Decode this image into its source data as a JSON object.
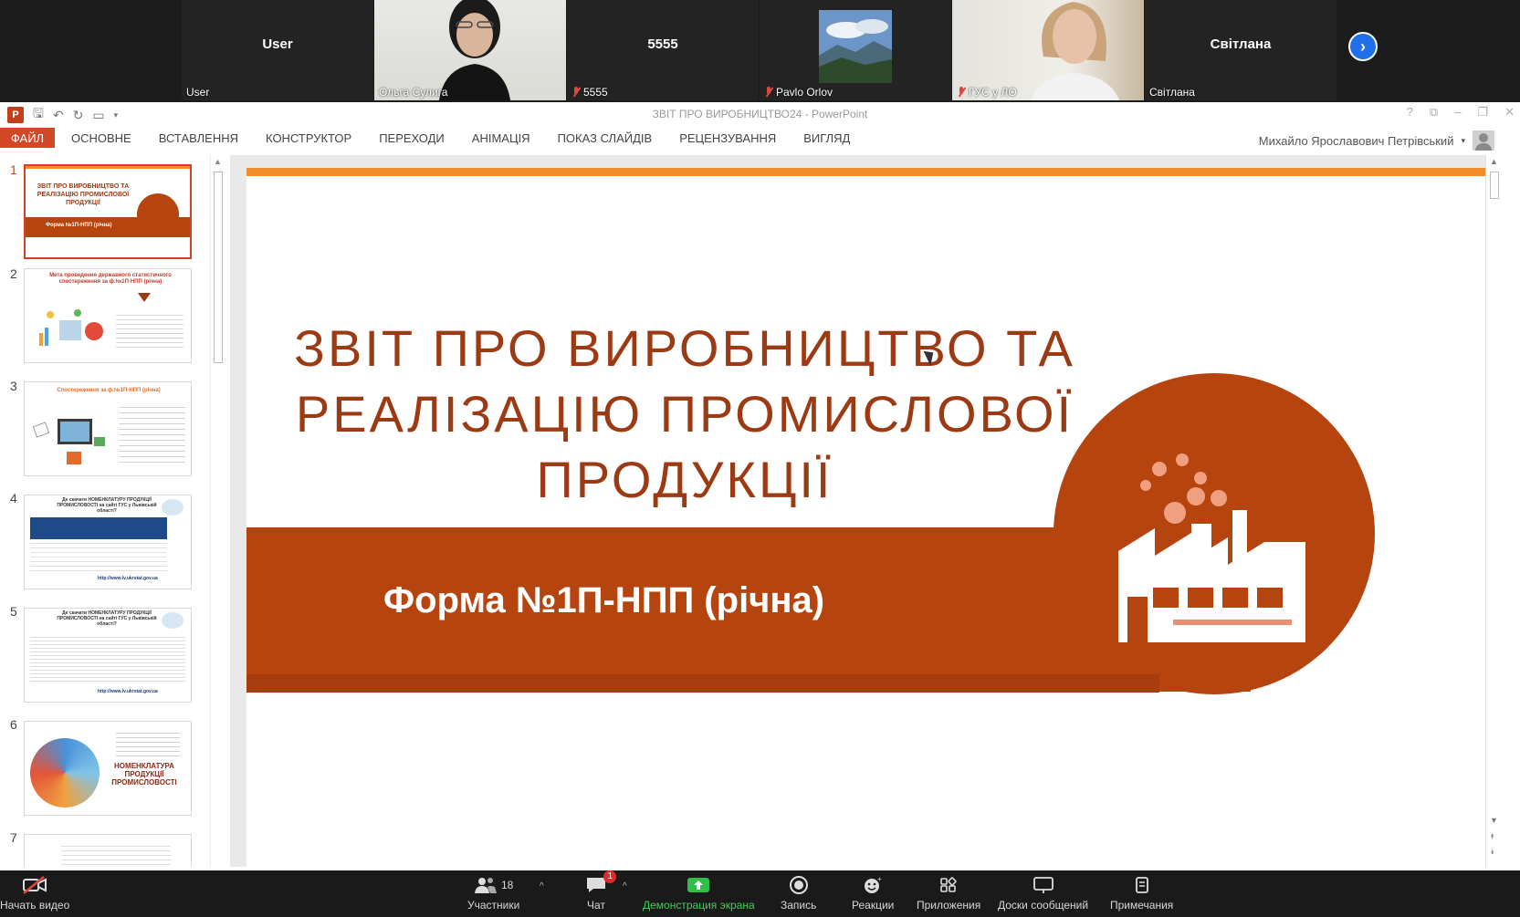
{
  "participants": {
    "tiles": [
      {
        "center_name": "User",
        "label": "User",
        "muted": false
      },
      {
        "center_name": "",
        "label": "Ольга Сулига",
        "muted": false,
        "video": true,
        "active": true
      },
      {
        "center_name": "5555",
        "label": "5555",
        "muted": true
      },
      {
        "center_name": "",
        "label": "Pavlo Orlov",
        "muted": true,
        "avatar_image": true
      },
      {
        "center_name": "",
        "label": "ГУС у ЛО",
        "muted": true,
        "video": true
      },
      {
        "center_name": "Світлана",
        "label": "Світлана",
        "muted": false
      }
    ],
    "next_icon": "chevron-right-icon"
  },
  "powerpoint": {
    "window_title": "ЗВІТ ПРО ВИРОБНИЦТВО24 - PowerPoint",
    "logo_letter": "P",
    "file_tab": "ФАЙЛ",
    "tabs": [
      "ОСНОВНЕ",
      "ВСТАВЛЕННЯ",
      "КОНСТРУКТОР",
      "ПЕРЕХОДИ",
      "АНІМАЦІЯ",
      "ПОКАЗ СЛАЙДІВ",
      "РЕЦЕНЗУВАННЯ",
      "ВИГЛЯД"
    ],
    "user_name": "Михайло Ярославович Петрівський",
    "window_controls": [
      "?",
      "⧉",
      "–",
      "❐",
      "✕"
    ],
    "thumbnails": [
      {
        "num": "1",
        "title": "ЗВІТ ПРО ВИРОБНИЦТВО ТА РЕАЛІЗАЦІЮ ПРОМИСЛОВОЇ ПРОДУКЦІЇ",
        "sub": "Форма №1П-НПП (річна)",
        "selected": true
      },
      {
        "num": "2",
        "title": "Мета проведення державного статистичного спостереження за ф.№1П-НПП (річна)"
      },
      {
        "num": "3",
        "title": "Спостереження за ф.№1П-НПП (річна)"
      },
      {
        "num": "4",
        "title": "Де скачати НОМЕНКЛАТУРУ ПРОДУКЦІЇ ПРОМИСЛОВОСТІ на сайті ГУС у Львівській області?",
        "url": "http://www.lv.ukrstat.gov.ua"
      },
      {
        "num": "5",
        "title": "Де скачати НОМЕНКЛАТУРУ ПРОДУКЦІЇ ПРОМИСЛОВОСТІ на сайті ГУС у Львівській області?",
        "url": "http://www.lv.ukrstat.gov.ua"
      },
      {
        "num": "6",
        "title": "НОМЕНКЛАТУРА ПРОДУКЦІЇ ПРОМИСЛОВОСТІ"
      },
      {
        "num": "7",
        "title": ""
      }
    ]
  },
  "slide": {
    "title_lines": [
      "ЗВІТ ПРО ВИРОБНИЦТВО ТА",
      "РЕАЛІЗАЦІЮ ПРОМИСЛОВОЇ",
      "ПРОДУКЦІЇ"
    ],
    "subtitle": "Форма №1П-НПП (річна)",
    "accent_color": "#b5440f",
    "topbar_color": "#f28c28",
    "title_color": "#9c3a14",
    "icon": "factory-icon"
  },
  "toolbar": {
    "start_video": "Начать видео",
    "participants": "Участники",
    "participants_count": "18",
    "chat": "Чат",
    "chat_badge": "1",
    "share": "Демонстрация экрана",
    "record": "Запись",
    "reactions": "Реакции",
    "apps": "Приложения",
    "whiteboards": "Доски сообщений",
    "notes": "Примечания"
  }
}
